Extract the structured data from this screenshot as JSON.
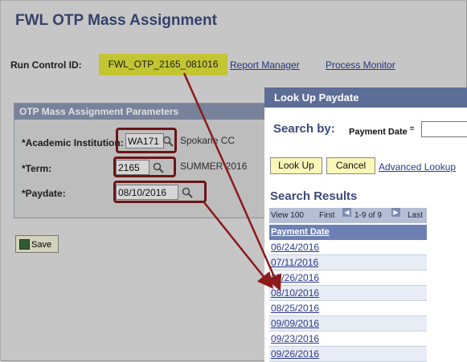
{
  "page": {
    "title": "FWL OTP Mass Assignment",
    "run_control_label": "Run Control ID:",
    "run_control_value": "FWL_OTP_2165_081016",
    "report_manager": "Report Manager",
    "process_monitor": "Process Monitor"
  },
  "params": {
    "header": "OTP Mass Assignment Parameters",
    "institution_label": "*Academic Institution:",
    "institution_value": "WA171",
    "institution_desc": "Spokane CC",
    "term_label": "*Term:",
    "term_value": "2165",
    "term_desc": "SUMMER 2016",
    "paydate_label": "*Paydate:",
    "paydate_value": "08/10/2016"
  },
  "save_label": "Save",
  "lookup": {
    "title": "Look Up Paydate",
    "search_by": "Search by:",
    "field_label": "Payment Date",
    "operator": "=",
    "lookup_button": "Look Up",
    "cancel_button": "Cancel",
    "advanced_link": "Advanced Lookup",
    "results_title": "Search Results",
    "nav_view": "View 100",
    "nav_first": "First",
    "nav_range": "1-9 of 9",
    "nav_last": "Last",
    "column_header": "Payment Date",
    "rows": [
      "06/24/2016",
      "07/11/2016",
      "07/26/2016",
      "08/10/2016",
      "08/25/2016",
      "09/09/2016",
      "09/23/2016",
      "09/26/2016"
    ]
  },
  "colors": {
    "highlight_box": "#7a1a1a",
    "run_control_bg": "#dfe23a",
    "dialog_header": "#5d6e96"
  }
}
